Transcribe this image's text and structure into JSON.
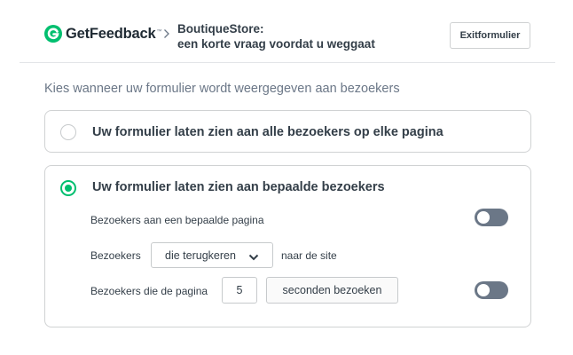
{
  "header": {
    "logo_text": "GetFeedback",
    "logo_tm": "™",
    "breadcrumb_line1": "BoutiqueStore:",
    "breadcrumb_line2": "een korte vraag voordat u weggaat",
    "exit_label": "Exitformulier"
  },
  "intro": "Kies wanneer uw formulier wordt weergegeven aan bezoekers",
  "options": [
    {
      "label": "Uw formulier laten zien aan alle bezoekers op elke pagina",
      "selected": false
    },
    {
      "label": "Uw formulier laten zien aan bepaalde bezoekers",
      "selected": true
    }
  ],
  "rules": {
    "page_visitors_label": "Bezoekers aan een bepaalde pagina",
    "page_visitors_enabled": false,
    "returning_prefix": "Bezoekers",
    "returning_select_value": "die terugkeren",
    "returning_suffix": "naar de site",
    "time_prefix": "Bezoekers die de pagina",
    "time_value": "5",
    "time_unit_button": "seconden bezoeken",
    "time_enabled": false
  },
  "colors": {
    "brand": "#00bf6f",
    "toggle_off": "#6b7787",
    "text": "#333e48",
    "muted": "#6b7787"
  }
}
